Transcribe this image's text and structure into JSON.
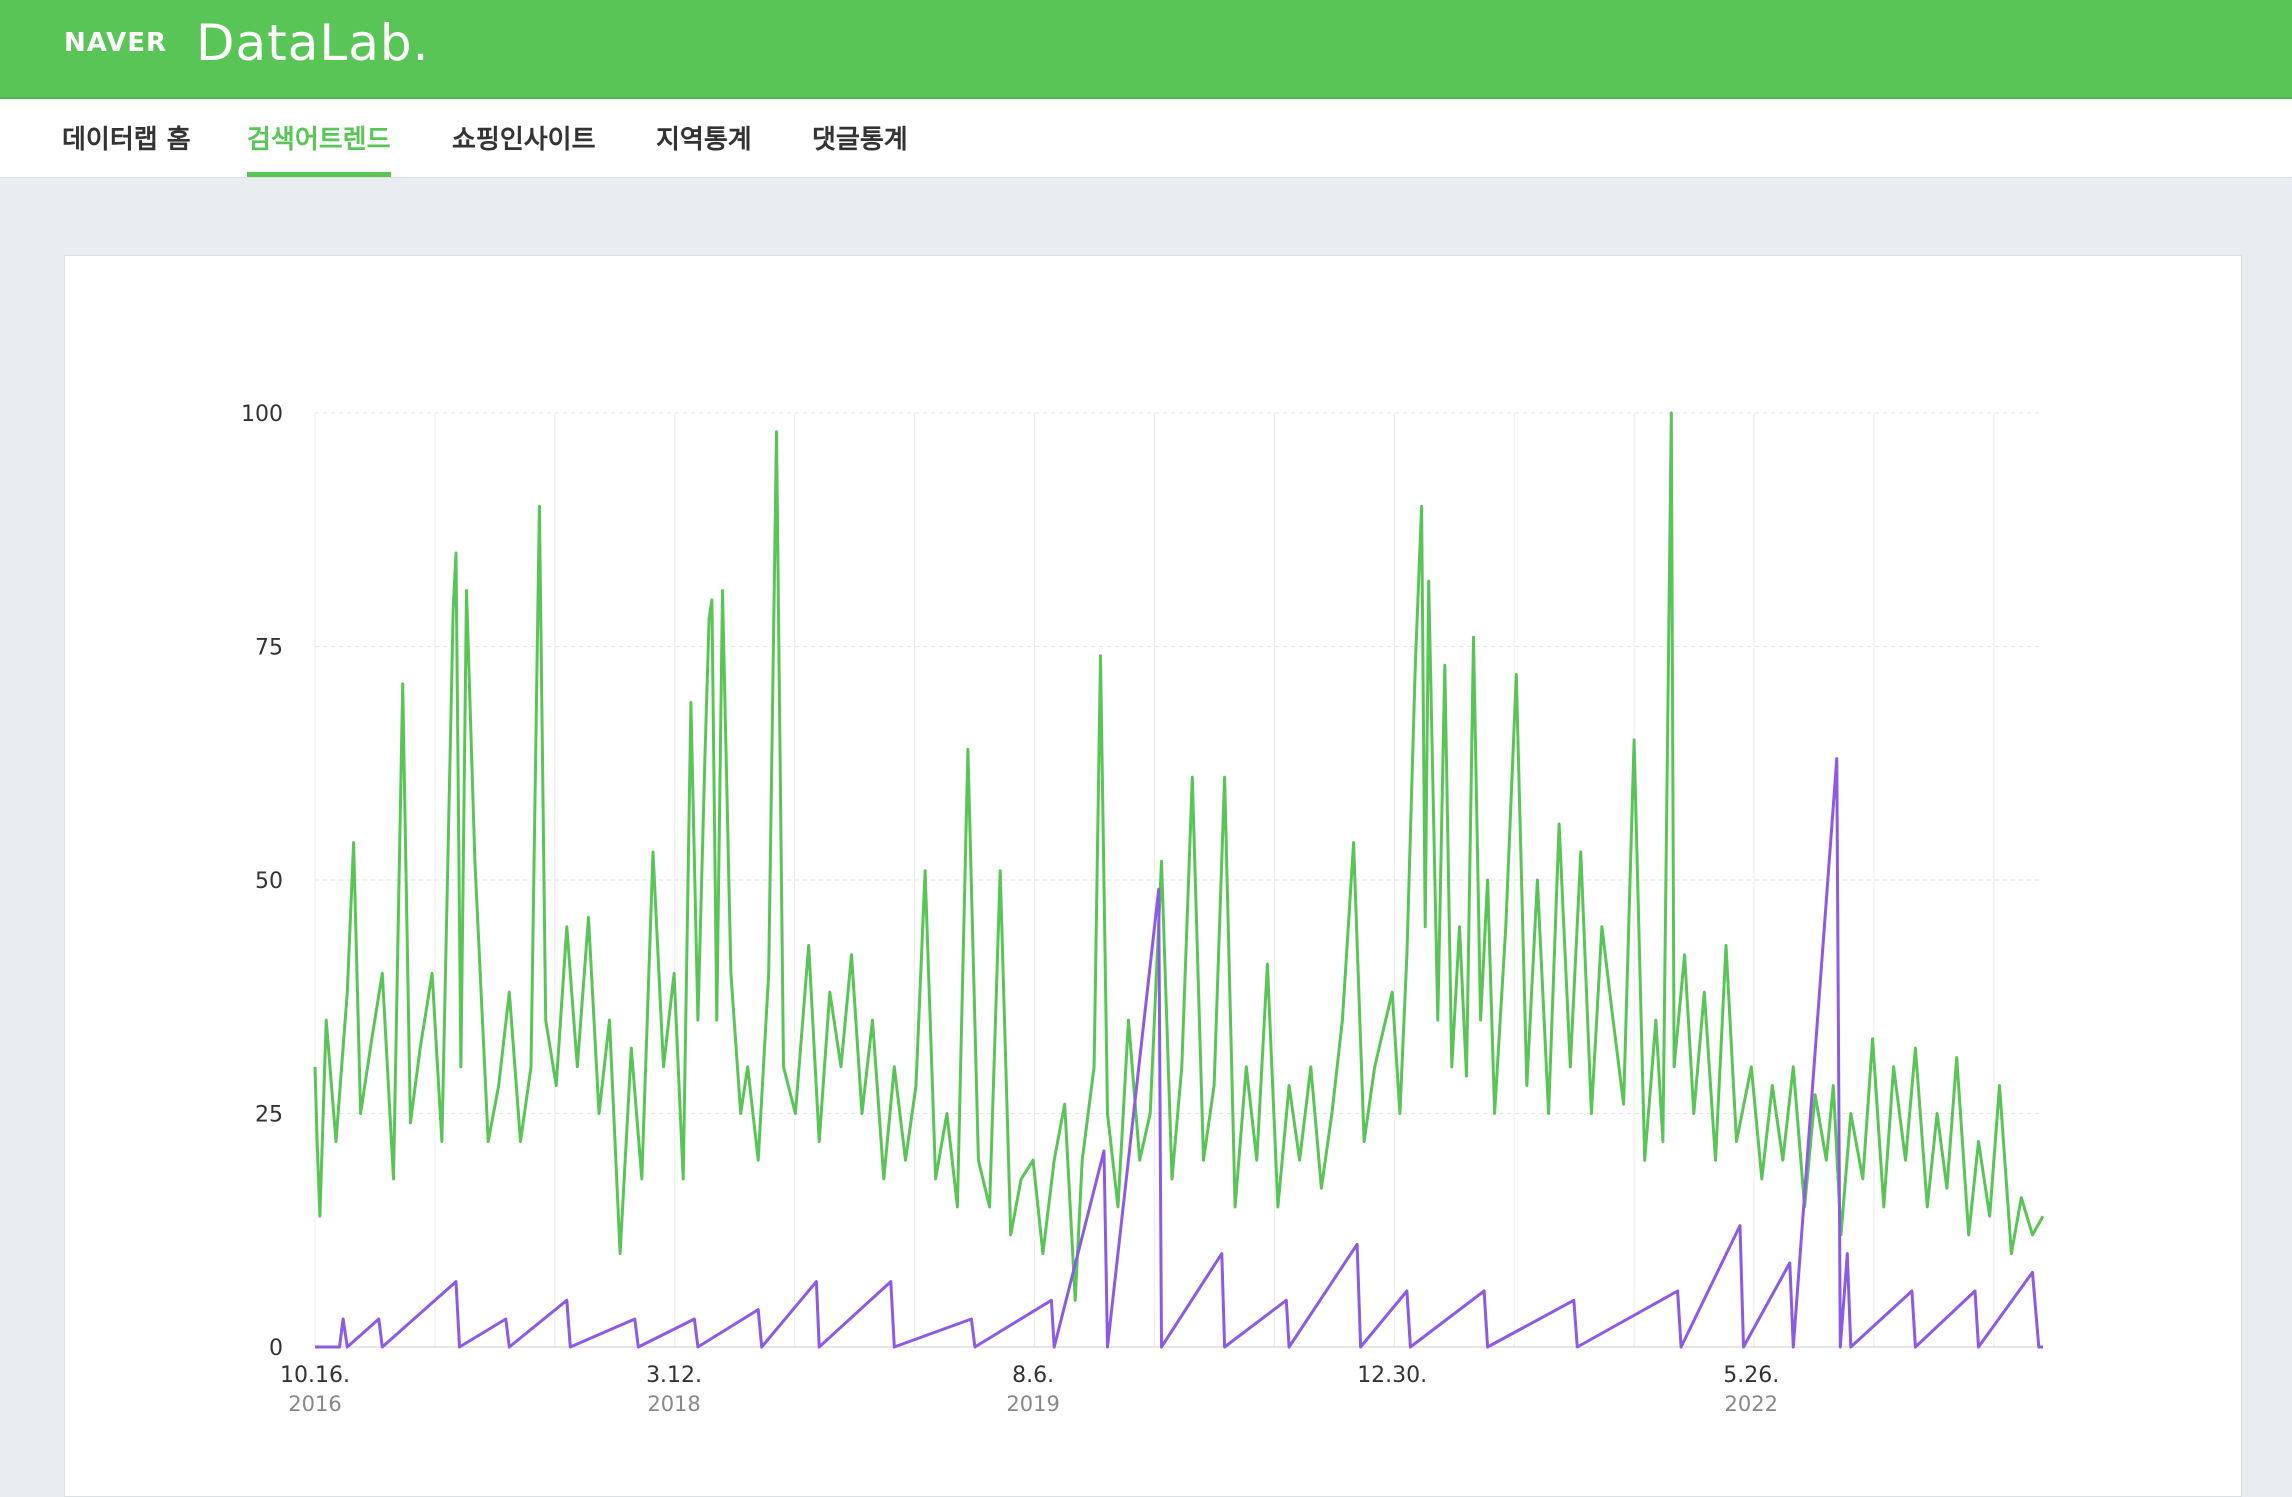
{
  "header": {
    "brand": "NAVER",
    "product": "DataLab."
  },
  "nav": {
    "items": [
      {
        "label": "데이터랩 홈",
        "active": false
      },
      {
        "label": "검색어트렌드",
        "active": true
      },
      {
        "label": "쇼핑인사이트",
        "active": false
      },
      {
        "label": "지역통계",
        "active": false
      },
      {
        "label": "댓글통계",
        "active": false
      }
    ]
  },
  "colors": {
    "accent": "#5ac557",
    "series_green": "#5ac557",
    "series_purple": "#8b5be6",
    "grid": "#e6e6e6"
  },
  "chart_data": {
    "type": "line",
    "title": "",
    "xlabel": "",
    "ylabel": "",
    "ylim": [
      0,
      100
    ],
    "y_ticks": [
      0,
      25,
      50,
      75,
      100
    ],
    "y_tick_labels": [
      "0",
      "25",
      "50",
      "75",
      "100"
    ],
    "x_range": [
      "2016-10-16",
      "2023-07-16"
    ],
    "x_ticks": [
      {
        "date": "2016-10-16",
        "label": "10.16.",
        "year": "2016"
      },
      {
        "date": "2018-03-12",
        "label": "3.12.",
        "year": "2018"
      },
      {
        "date": "2019-08-06",
        "label": "8.6.",
        "year": "2019"
      },
      {
        "date": "2020-12-30",
        "label": "12.30.",
        "year": ""
      },
      {
        "date": "2022-05-26",
        "label": "5.26.",
        "year": "2022"
      }
    ],
    "grid": true,
    "legend": "none",
    "series": [
      {
        "color": "#5ac557",
        "points": [
          [
            "2016-10-16",
            30
          ],
          [
            "2016-10-19",
            22
          ],
          [
            "2016-10-23",
            14
          ],
          [
            "2016-11-01",
            35
          ],
          [
            "2016-11-15",
            22
          ],
          [
            "2016-12-01",
            38
          ],
          [
            "2016-12-10",
            54
          ],
          [
            "2016-12-20",
            25
          ],
          [
            "2017-01-05",
            33
          ],
          [
            "2017-01-20",
            40
          ],
          [
            "2017-02-05",
            18
          ],
          [
            "2017-02-18",
            71
          ],
          [
            "2017-03-01",
            24
          ],
          [
            "2017-03-15",
            32
          ],
          [
            "2017-04-01",
            40
          ],
          [
            "2017-04-15",
            22
          ],
          [
            "2017-05-01",
            79
          ],
          [
            "2017-05-05",
            85
          ],
          [
            "2017-05-12",
            30
          ],
          [
            "2017-05-20",
            81
          ],
          [
            "2017-06-01",
            52
          ],
          [
            "2017-06-20",
            22
          ],
          [
            "2017-07-05",
            28
          ],
          [
            "2017-07-20",
            38
          ],
          [
            "2017-08-05",
            22
          ],
          [
            "2017-08-20",
            30
          ],
          [
            "2017-09-01",
            90
          ],
          [
            "2017-09-10",
            35
          ],
          [
            "2017-09-25",
            28
          ],
          [
            "2017-10-10",
            45
          ],
          [
            "2017-10-25",
            30
          ],
          [
            "2017-11-10",
            46
          ],
          [
            "2017-11-25",
            25
          ],
          [
            "2017-12-10",
            35
          ],
          [
            "2017-12-25",
            10
          ],
          [
            "2018-01-10",
            32
          ],
          [
            "2018-01-25",
            18
          ],
          [
            "2018-02-10",
            53
          ],
          [
            "2018-02-25",
            30
          ],
          [
            "2018-03-12",
            40
          ],
          [
            "2018-03-25",
            18
          ],
          [
            "2018-04-05",
            69
          ],
          [
            "2018-04-15",
            35
          ],
          [
            "2018-04-25",
            63
          ],
          [
            "2018-05-01",
            78
          ],
          [
            "2018-05-05",
            80
          ],
          [
            "2018-05-12",
            35
          ],
          [
            "2018-05-20",
            81
          ],
          [
            "2018-06-01",
            40
          ],
          [
            "2018-06-15",
            25
          ],
          [
            "2018-06-25",
            30
          ],
          [
            "2018-07-10",
            20
          ],
          [
            "2018-07-25",
            40
          ],
          [
            "2018-08-05",
            98
          ],
          [
            "2018-08-15",
            30
          ],
          [
            "2018-09-01",
            25
          ],
          [
            "2018-09-20",
            43
          ],
          [
            "2018-10-05",
            22
          ],
          [
            "2018-10-20",
            38
          ],
          [
            "2018-11-05",
            30
          ],
          [
            "2018-11-20",
            42
          ],
          [
            "2018-12-05",
            25
          ],
          [
            "2018-12-20",
            35
          ],
          [
            "2019-01-05",
            18
          ],
          [
            "2019-01-20",
            30
          ],
          [
            "2019-02-05",
            20
          ],
          [
            "2019-02-20",
            28
          ],
          [
            "2019-03-05",
            51
          ],
          [
            "2019-03-20",
            18
          ],
          [
            "2019-04-05",
            25
          ],
          [
            "2019-04-20",
            15
          ],
          [
            "2019-05-05",
            64
          ],
          [
            "2019-05-20",
            20
          ],
          [
            "2019-06-05",
            15
          ],
          [
            "2019-06-20",
            51
          ],
          [
            "2019-07-05",
            12
          ],
          [
            "2019-07-20",
            18
          ],
          [
            "2019-08-06",
            20
          ],
          [
            "2019-08-20",
            10
          ],
          [
            "2019-09-05",
            20
          ],
          [
            "2019-09-20",
            26
          ],
          [
            "2019-10-05",
            5
          ],
          [
            "2019-10-15",
            20
          ],
          [
            "2019-11-01",
            30
          ],
          [
            "2019-11-10",
            74
          ],
          [
            "2019-11-20",
            25
          ],
          [
            "2019-12-05",
            15
          ],
          [
            "2019-12-20",
            35
          ],
          [
            "2020-01-05",
            20
          ],
          [
            "2020-01-20",
            25
          ],
          [
            "2020-02-05",
            52
          ],
          [
            "2020-02-20",
            18
          ],
          [
            "2020-03-05",
            30
          ],
          [
            "2020-03-20",
            61
          ],
          [
            "2020-04-05",
            20
          ],
          [
            "2020-04-20",
            28
          ],
          [
            "2020-05-05",
            61
          ],
          [
            "2020-05-20",
            15
          ],
          [
            "2020-06-05",
            30
          ],
          [
            "2020-06-20",
            20
          ],
          [
            "2020-07-05",
            41
          ],
          [
            "2020-07-20",
            15
          ],
          [
            "2020-08-05",
            28
          ],
          [
            "2020-08-20",
            20
          ],
          [
            "2020-09-05",
            30
          ],
          [
            "2020-09-20",
            17
          ],
          [
            "2020-10-05",
            25
          ],
          [
            "2020-10-20",
            35
          ],
          [
            "2020-11-05",
            54
          ],
          [
            "2020-11-20",
            22
          ],
          [
            "2020-12-05",
            30
          ],
          [
            "2020-12-30",
            38
          ],
          [
            "2021-01-10",
            25
          ],
          [
            "2021-01-20",
            42
          ],
          [
            "2021-02-01",
            73
          ],
          [
            "2021-02-10",
            90
          ],
          [
            "2021-02-15",
            45
          ],
          [
            "2021-02-20",
            82
          ],
          [
            "2021-03-05",
            35
          ],
          [
            "2021-03-15",
            73
          ],
          [
            "2021-03-25",
            30
          ],
          [
            "2021-04-05",
            45
          ],
          [
            "2021-04-15",
            29
          ],
          [
            "2021-04-25",
            76
          ],
          [
            "2021-05-05",
            35
          ],
          [
            "2021-05-15",
            50
          ],
          [
            "2021-05-25",
            25
          ],
          [
            "2021-06-10",
            45
          ],
          [
            "2021-06-25",
            72
          ],
          [
            "2021-07-10",
            28
          ],
          [
            "2021-07-25",
            50
          ],
          [
            "2021-08-10",
            25
          ],
          [
            "2021-08-25",
            56
          ],
          [
            "2021-09-10",
            30
          ],
          [
            "2021-09-25",
            53
          ],
          [
            "2021-10-10",
            25
          ],
          [
            "2021-10-25",
            45
          ],
          [
            "2021-11-10",
            35
          ],
          [
            "2021-11-25",
            26
          ],
          [
            "2021-12-10",
            65
          ],
          [
            "2021-12-25",
            20
          ],
          [
            "2022-01-10",
            35
          ],
          [
            "2022-01-20",
            22
          ],
          [
            "2022-02-01",
            100
          ],
          [
            "2022-02-05",
            30
          ],
          [
            "2022-02-20",
            42
          ],
          [
            "2022-03-05",
            25
          ],
          [
            "2022-03-20",
            38
          ],
          [
            "2022-04-05",
            20
          ],
          [
            "2022-04-20",
            43
          ],
          [
            "2022-05-05",
            22
          ],
          [
            "2022-05-26",
            30
          ],
          [
            "2022-06-10",
            18
          ],
          [
            "2022-06-25",
            28
          ],
          [
            "2022-07-10",
            20
          ],
          [
            "2022-07-25",
            30
          ],
          [
            "2022-08-10",
            15
          ],
          [
            "2022-08-25",
            27
          ],
          [
            "2022-09-10",
            20
          ],
          [
            "2022-09-20",
            28
          ],
          [
            "2022-10-01",
            12
          ],
          [
            "2022-10-15",
            25
          ],
          [
            "2022-11-01",
            18
          ],
          [
            "2022-11-15",
            33
          ],
          [
            "2022-12-01",
            15
          ],
          [
            "2022-12-15",
            30
          ],
          [
            "2023-01-01",
            20
          ],
          [
            "2023-01-15",
            32
          ],
          [
            "2023-02-01",
            15
          ],
          [
            "2023-02-15",
            25
          ],
          [
            "2023-03-01",
            17
          ],
          [
            "2023-03-15",
            31
          ],
          [
            "2023-04-01",
            12
          ],
          [
            "2023-04-15",
            22
          ],
          [
            "2023-05-01",
            14
          ],
          [
            "2023-05-15",
            28
          ],
          [
            "2023-06-01",
            10
          ],
          [
            "2023-06-15",
            16
          ],
          [
            "2023-07-01",
            12
          ],
          [
            "2023-07-16",
            14
          ]
        ]
      },
      {
        "color": "#8b5be6",
        "points": [
          [
            "2016-10-16",
            0
          ],
          [
            "2016-11-20",
            0
          ],
          [
            "2016-11-25",
            3
          ],
          [
            "2016-12-01",
            0
          ],
          [
            "2017-01-15",
            3
          ],
          [
            "2017-01-20",
            0
          ],
          [
            "2017-05-05",
            7
          ],
          [
            "2017-05-10",
            0
          ],
          [
            "2017-07-15",
            3
          ],
          [
            "2017-07-20",
            0
          ],
          [
            "2017-10-10",
            5
          ],
          [
            "2017-10-15",
            0
          ],
          [
            "2018-01-15",
            3
          ],
          [
            "2018-01-20",
            0
          ],
          [
            "2018-04-10",
            3
          ],
          [
            "2018-04-15",
            0
          ],
          [
            "2018-07-10",
            4
          ],
          [
            "2018-07-15",
            0
          ],
          [
            "2018-10-01",
            7
          ],
          [
            "2018-10-05",
            0
          ],
          [
            "2019-01-15",
            7
          ],
          [
            "2019-01-20",
            0
          ],
          [
            "2019-05-10",
            3
          ],
          [
            "2019-05-15",
            0
          ],
          [
            "2019-09-01",
            5
          ],
          [
            "2019-09-05",
            0
          ],
          [
            "2019-11-15",
            21
          ],
          [
            "2019-11-20",
            0
          ],
          [
            "2020-02-01",
            49
          ],
          [
            "2020-02-05",
            0
          ],
          [
            "2020-05-01",
            10
          ],
          [
            "2020-05-05",
            0
          ],
          [
            "2020-08-01",
            5
          ],
          [
            "2020-08-05",
            0
          ],
          [
            "2020-11-10",
            11
          ],
          [
            "2020-11-15",
            0
          ],
          [
            "2021-01-20",
            6
          ],
          [
            "2021-01-25",
            0
          ],
          [
            "2021-05-10",
            6
          ],
          [
            "2021-05-15",
            0
          ],
          [
            "2021-09-15",
            5
          ],
          [
            "2021-09-20",
            0
          ],
          [
            "2022-02-10",
            6
          ],
          [
            "2022-02-15",
            0
          ],
          [
            "2022-05-10",
            13
          ],
          [
            "2022-05-15",
            0
          ],
          [
            "2022-07-20",
            9
          ],
          [
            "2022-07-25",
            0
          ],
          [
            "2022-09-25",
            63
          ],
          [
            "2022-09-30",
            0
          ],
          [
            "2022-10-10",
            10
          ],
          [
            "2022-10-15",
            0
          ],
          [
            "2023-01-10",
            6
          ],
          [
            "2023-01-15",
            0
          ],
          [
            "2023-04-10",
            6
          ],
          [
            "2023-04-15",
            0
          ],
          [
            "2023-07-01",
            8
          ],
          [
            "2023-07-10",
            0
          ],
          [
            "2023-07-16",
            0
          ]
        ]
      }
    ]
  }
}
